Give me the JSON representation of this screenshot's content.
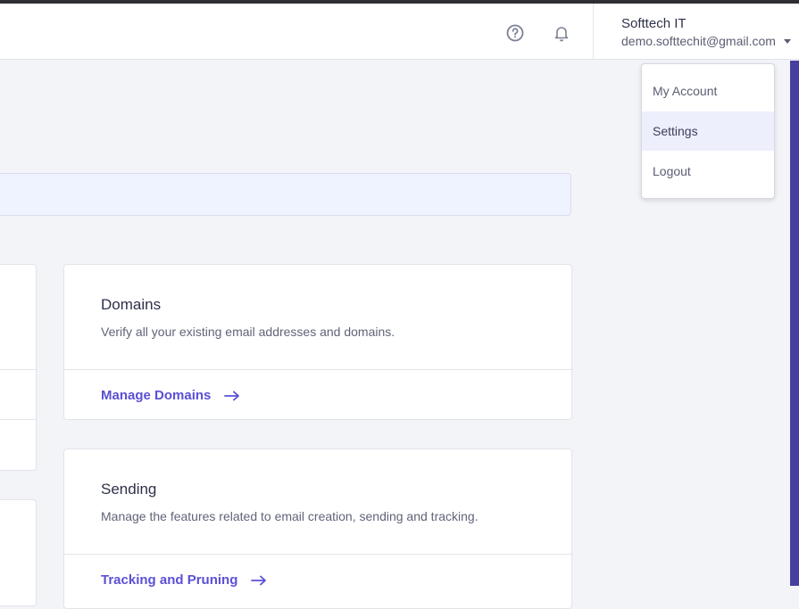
{
  "header": {
    "user_name": "Softtech IT",
    "user_email": "demo.softtechit@gmail.com",
    "icons": [
      "help-circle-icon",
      "bell-icon",
      "caret-down-icon"
    ]
  },
  "dropdown": {
    "items": [
      {
        "label": "My Account",
        "active": false
      },
      {
        "label": "Settings",
        "active": true
      },
      {
        "label": "Logout",
        "active": false
      }
    ]
  },
  "cards": [
    {
      "title": "Domains",
      "description": "Verify all your existing email addresses and domains.",
      "link": "Manage Domains"
    },
    {
      "title": "Sending",
      "description": "Manage the features related to email creation, sending and tracking.",
      "link": "Tracking and Pruning"
    }
  ],
  "colors": {
    "accent": "#5a50d6",
    "sidebar_accent": "#473f9f",
    "background": "#f3f4f8"
  }
}
